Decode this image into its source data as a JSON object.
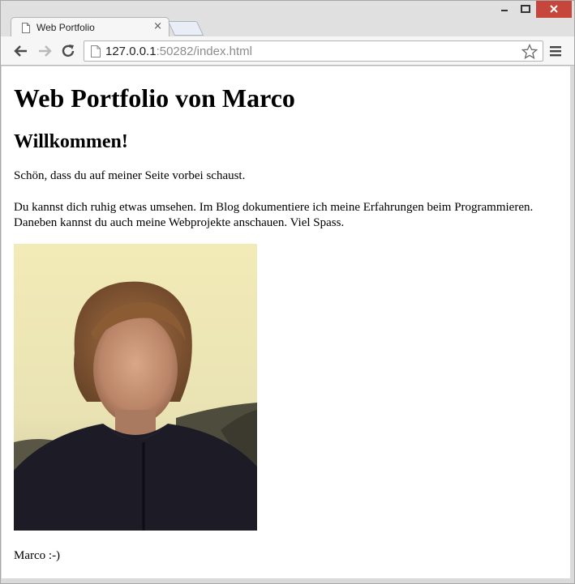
{
  "browser": {
    "tab_title": "Web Portfolio",
    "tab_close": "×",
    "url_host": "127.0.0.1",
    "url_path": ":50282/index.html",
    "window_close_color": "#c7463b"
  },
  "page": {
    "heading": "Web Portfolio von Marco",
    "subheading": "Willkommen!",
    "paragraph1": "Schön, dass du auf meiner Seite vorbei schaust.",
    "paragraph2": "Du kannst dich ruhig etwas umsehen. Im Blog dokumentiere ich meine Erfahrungen beim Programmieren. Daneben kannst du auch meine Webprojekte anschauen. Viel Spass.",
    "signature": "Marco :-)"
  }
}
